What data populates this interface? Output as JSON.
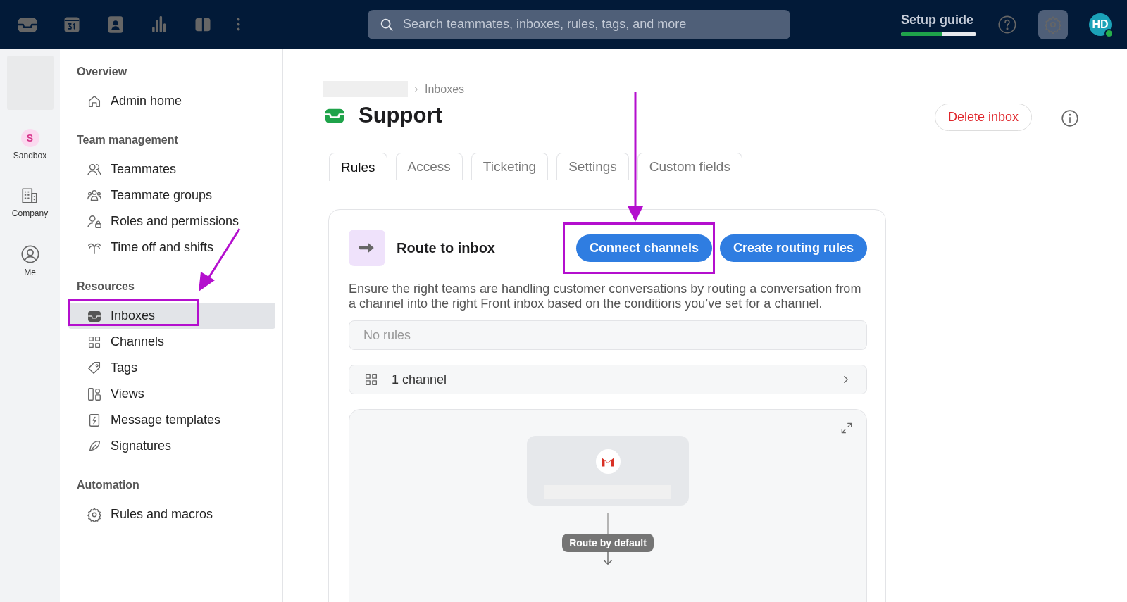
{
  "topbar": {
    "search": {
      "placeholder": "Search teammates, inboxes, rules, tags, and more"
    },
    "setup_guide": {
      "label": "Setup guide",
      "level": 0.55
    },
    "avatar": "HD"
  },
  "rail": [
    {
      "label": "Sandbox",
      "kind": "workspace",
      "initial": "S"
    },
    {
      "label": "Company",
      "kind": "company"
    },
    {
      "label": "Me",
      "kind": "me"
    }
  ],
  "sidebar": [
    {
      "title": "Overview",
      "items": [
        {
          "label": "Admin home",
          "selected": false
        }
      ]
    },
    {
      "title": "Team management",
      "items": [
        {
          "label": "Teammates",
          "selected": false
        },
        {
          "label": "Teammate groups",
          "selected": false
        },
        {
          "label": "Roles and permissions",
          "selected": false
        },
        {
          "label": "Time off and shifts",
          "selected": false
        }
      ]
    },
    {
      "title": "Resources",
      "items": [
        {
          "label": "Inboxes",
          "selected": true
        },
        {
          "label": "Channels",
          "selected": false
        },
        {
          "label": "Tags",
          "selected": false
        },
        {
          "label": "Views",
          "selected": false
        },
        {
          "label": "Message templates",
          "selected": false
        },
        {
          "label": "Signatures",
          "selected": false
        }
      ]
    },
    {
      "title": "Automation",
      "items": [
        {
          "label": "Rules and macros",
          "selected": false
        }
      ]
    }
  ],
  "breadcrumb": "Inboxes",
  "title": "Support",
  "delete_button": "Delete inbox",
  "tabs": [
    {
      "label": "Rules",
      "selected": true
    },
    {
      "label": "Access",
      "selected": false
    },
    {
      "label": "Ticketing",
      "selected": false
    },
    {
      "label": "Settings",
      "selected": false
    },
    {
      "label": "Custom fields",
      "selected": false
    }
  ],
  "card": {
    "title": "Route to inbox",
    "buttons": [
      "Connect channels",
      "Create routing rules"
    ],
    "description": "Ensure the right teams are handling customer conversations by routing a conversation from a channel into the right Front inbox based on the conditions you’ve set for a channel.",
    "rules_placeholder": "No rules",
    "channels_row": "1 channel",
    "diagram_label": "Route by default"
  }
}
